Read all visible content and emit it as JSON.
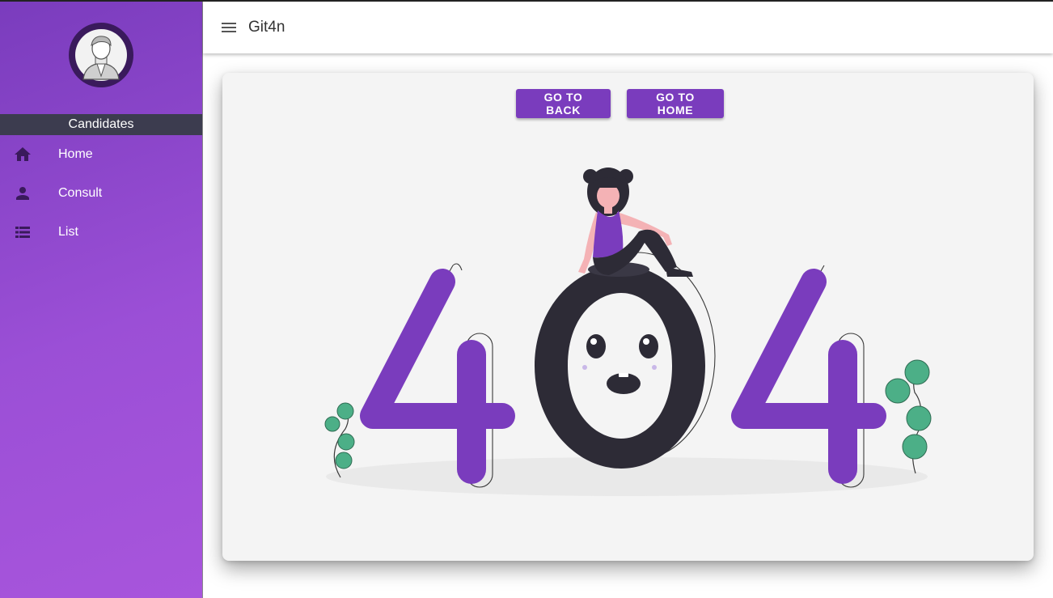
{
  "app": {
    "title": "Git4n"
  },
  "sidebar": {
    "header": "Candidates",
    "items": [
      {
        "label": "Home",
        "icon": "home-icon"
      },
      {
        "label": "Consult",
        "icon": "person-icon"
      },
      {
        "label": "List",
        "icon": "list-icon"
      }
    ]
  },
  "actions": {
    "back_label": "GO TO BACK",
    "home_label": "GO TO HOME"
  },
  "colors": {
    "accent": "#7a3cbd",
    "dark": "#2d2b36",
    "leaf": "#4caf87"
  }
}
